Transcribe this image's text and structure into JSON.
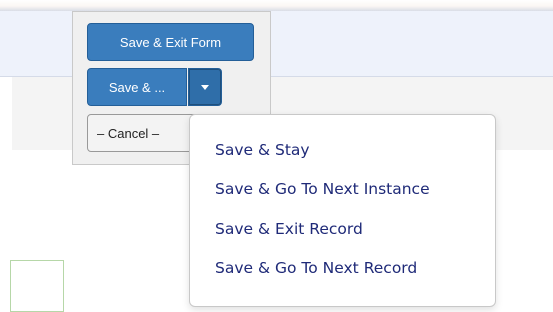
{
  "form_actions": {
    "save_exit_form_label": "Save & Exit Form",
    "save_more_label": "Save & ...",
    "cancel_label": "– Cancel –",
    "caret_icon": "caret-down-icon"
  },
  "save_menu": {
    "items": [
      {
        "label": "Save & Stay"
      },
      {
        "label": "Save & Go To Next Instance"
      },
      {
        "label": "Save & Exit Record"
      },
      {
        "label": "Save & Go To Next Record"
      }
    ]
  },
  "colors": {
    "primary_button": "#3a7dbd",
    "menu_text": "#1f2a78",
    "header_band": "#eef2fb"
  }
}
